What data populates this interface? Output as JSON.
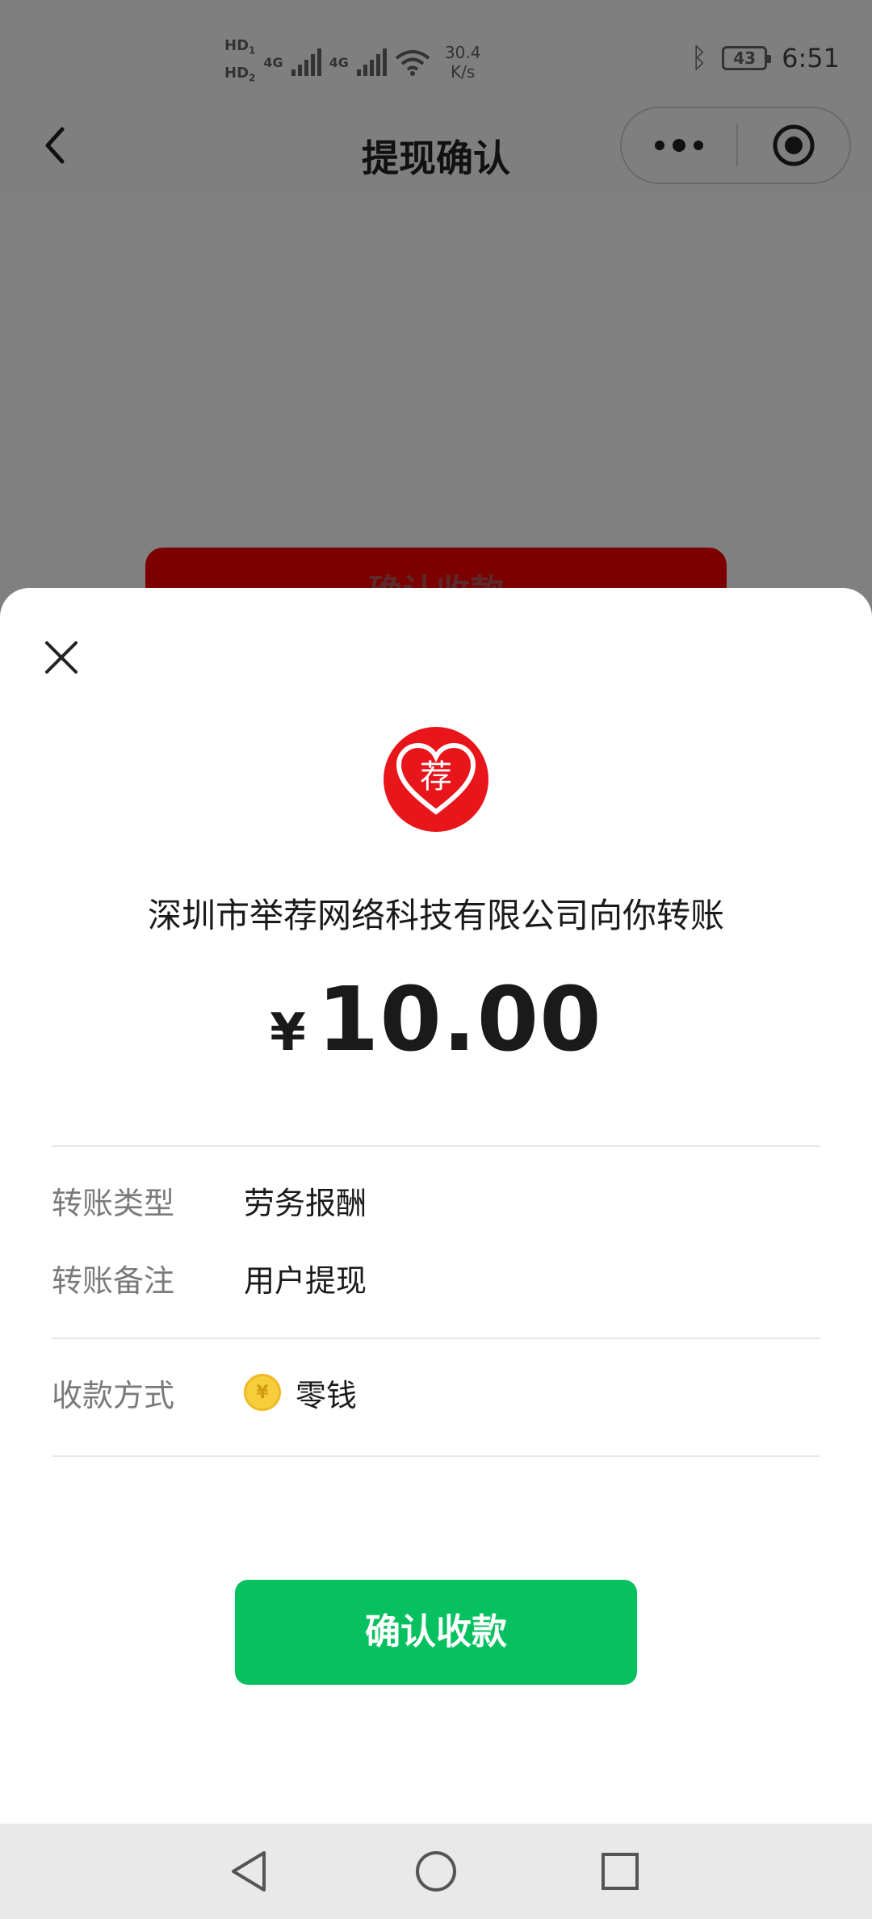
{
  "status_bar": {
    "hd1": "HD",
    "hd1_sub": "1",
    "hd2": "HD",
    "hd2_sub": "2",
    "net1": "4G",
    "net2": "4G",
    "speed_value": "30.4",
    "speed_unit": "K/s",
    "battery": "43",
    "time": "6:51"
  },
  "nav": {
    "title": "提现确认"
  },
  "background": {
    "button_label": "确认收款"
  },
  "sheet": {
    "payer_text": "深圳市举荐网络科技有限公司向你转账",
    "logo_char": "荐",
    "currency": "¥",
    "amount": "10.00",
    "rows": [
      {
        "label": "转账类型",
        "value": "劳务报酬"
      },
      {
        "label": "转账备注",
        "value": "用户提现"
      }
    ],
    "method": {
      "label": "收款方式",
      "value": "零钱",
      "coin_symbol": "¥"
    },
    "confirm_label": "确认收款"
  },
  "colors": {
    "accent_green": "#07c160",
    "logo_red": "#e8151b",
    "coin_yellow": "#f6cd3b"
  }
}
